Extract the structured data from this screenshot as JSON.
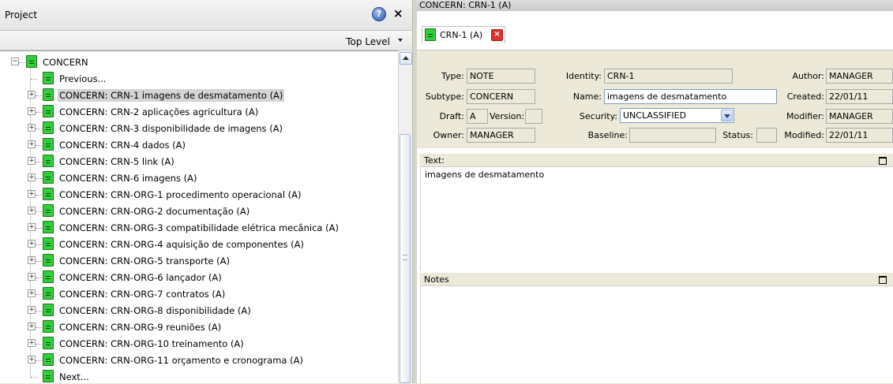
{
  "project_panel": {
    "title": "Project",
    "level_selector": "Top Level"
  },
  "tree": {
    "root": "CONCERN",
    "previous": "Previous...",
    "next": "Next...",
    "items": [
      "CONCERN: CRN-1  imagens de desmatamento (A)",
      "CONCERN: CRN-2  aplicações agricultura (A)",
      "CONCERN: CRN-3  disponibilidade de imagens (A)",
      "CONCERN: CRN-4  dados (A)",
      "CONCERN: CRN-5  link (A)",
      "CONCERN: CRN-6  imagens (A)",
      "CONCERN: CRN-ORG-1  procedimento operacional (A)",
      "CONCERN: CRN-ORG-2  documentação (A)",
      "CONCERN: CRN-ORG-3  compatibilidade elétrica mecânica (A)",
      "CONCERN: CRN-ORG-4  aquisição de componentes (A)",
      "CONCERN: CRN-ORG-5  transporte (A)",
      "CONCERN: CRN-ORG-6  lançador (A)",
      "CONCERN: CRN-ORG-7  contratos (A)",
      "CONCERN: CRN-ORG-8  disponibilidade (A)",
      "CONCERN: CRN-ORG-9  reuniões (A)",
      "CONCERN: CRN-ORG-10  treinamento (A)",
      "CONCERN: CRN-ORG-11  orçamento e cronograma (A)"
    ]
  },
  "editor": {
    "window_title": "CONCERN: CRN-1 (A)",
    "tab_label": "CRN-1 (A)",
    "fields": {
      "type_label": "Type:",
      "type": "NOTE",
      "subtype_label": "Subtype:",
      "subtype": "CONCERN",
      "draft_label": "Draft:",
      "draft": "A",
      "version_label": "Version:",
      "version": "",
      "owner_label": "Owner:",
      "owner": "MANAGER",
      "identity_label": "Identity:",
      "identity": "CRN-1",
      "name_label": "Name:",
      "name": "imagens de desmatamento",
      "security_label": "Security:",
      "security": "UNCLASSIFIED",
      "baseline_label": "Baseline:",
      "baseline": "",
      "status_label": "Status:",
      "status": "",
      "author_label": "Author:",
      "author": "MANAGER",
      "created_label": "Created:",
      "created": "22/01/11",
      "modifier_label": "Modifier:",
      "modifier": "MANAGER",
      "modified_label": "Modified:",
      "modified": "22/01/11"
    },
    "text_label": "Text:",
    "text_content": "imagens de desmatamento",
    "notes_label": "Notes"
  }
}
